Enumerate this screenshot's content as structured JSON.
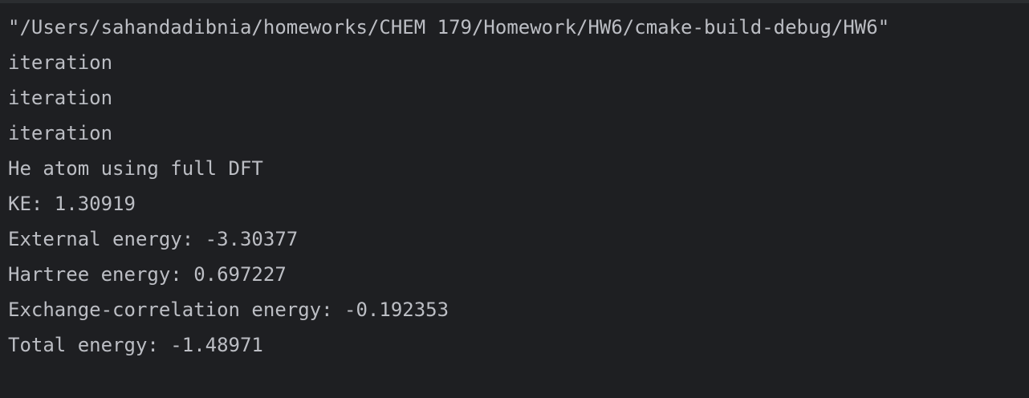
{
  "console": {
    "lines": [
      "\"/Users/sahandadibnia/homeworks/CHEM 179/Homework/HW6/cmake-build-debug/HW6\"",
      "iteration",
      "iteration",
      "iteration",
      "He atom using full DFT",
      "KE: 1.30919",
      "External energy: -3.30377",
      "Hartree energy: 0.697227",
      "Exchange-correlation energy: -0.192353",
      "Total energy: -1.48971"
    ]
  },
  "colors": {
    "background": "#1e1f22",
    "text": "#bcbec4"
  }
}
